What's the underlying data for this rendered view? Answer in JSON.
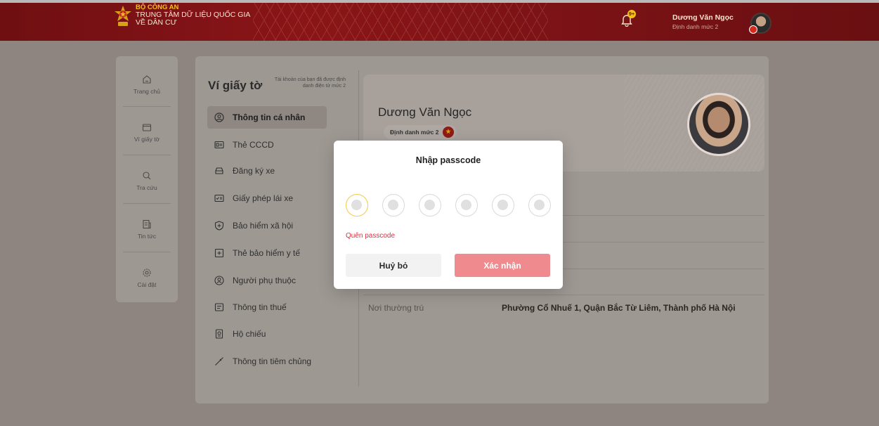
{
  "header": {
    "org_line1": "BỘ CÔNG AN",
    "org_line2": "TRUNG TÂM DỮ LIỆU QUỐC GIA",
    "org_line3": "VỀ DÂN CƯ",
    "notification_badge": "9+",
    "user_name": "Dương Văn Ngọc",
    "user_level": "Định danh mức 2",
    "brand_color": "#7d1316"
  },
  "sidebar": {
    "items": [
      {
        "label": "Trang chủ",
        "icon": "home-icon"
      },
      {
        "label": "Ví giấy tờ",
        "icon": "wallet-icon"
      },
      {
        "label": "Tra cứu",
        "icon": "search-icon"
      },
      {
        "label": "Tin tức",
        "icon": "news-icon"
      },
      {
        "label": "Cài đặt",
        "icon": "gear-icon"
      }
    ]
  },
  "page": {
    "title": "Ví giấy tờ",
    "note": "Tài khoản của bạn đã được định danh điện tử mức 2"
  },
  "menu": {
    "items": [
      {
        "label": "Thông tin cá nhân",
        "icon": "user-circle-icon",
        "active": true
      },
      {
        "label": "Thẻ CCCD",
        "icon": "id-card-icon"
      },
      {
        "label": "Đăng ký xe",
        "icon": "car-icon"
      },
      {
        "label": "Giấy phép lái xe",
        "icon": "license-icon"
      },
      {
        "label": "Bảo hiểm xã hội",
        "icon": "shield-plus-icon"
      },
      {
        "label": "Thẻ bảo hiểm y tế",
        "icon": "medical-card-icon"
      },
      {
        "label": "Người phụ thuộc",
        "icon": "dependent-icon"
      },
      {
        "label": "Thông tin thuế",
        "icon": "tax-icon"
      },
      {
        "label": "Hộ chiếu",
        "icon": "passport-icon"
      },
      {
        "label": "Thông tin tiêm chủng",
        "icon": "syringe-icon"
      }
    ]
  },
  "profile": {
    "name": "Dương Văn Ngọc",
    "level": "Định danh mức 2",
    "residence_label": "Nơi thường trú",
    "residence_value": "Phường Cổ Nhuế 1, Quận Bắc Từ Liêm, Thành phố Hà Nội"
  },
  "modal": {
    "title": "Nhập passcode",
    "forgot_label": "Quên passcode",
    "cancel_label": "Huỷ bỏ",
    "confirm_label": "Xác nhận",
    "digits": 6,
    "accent_color": "#e5293a",
    "confirm_color": "#ef8a8e"
  }
}
